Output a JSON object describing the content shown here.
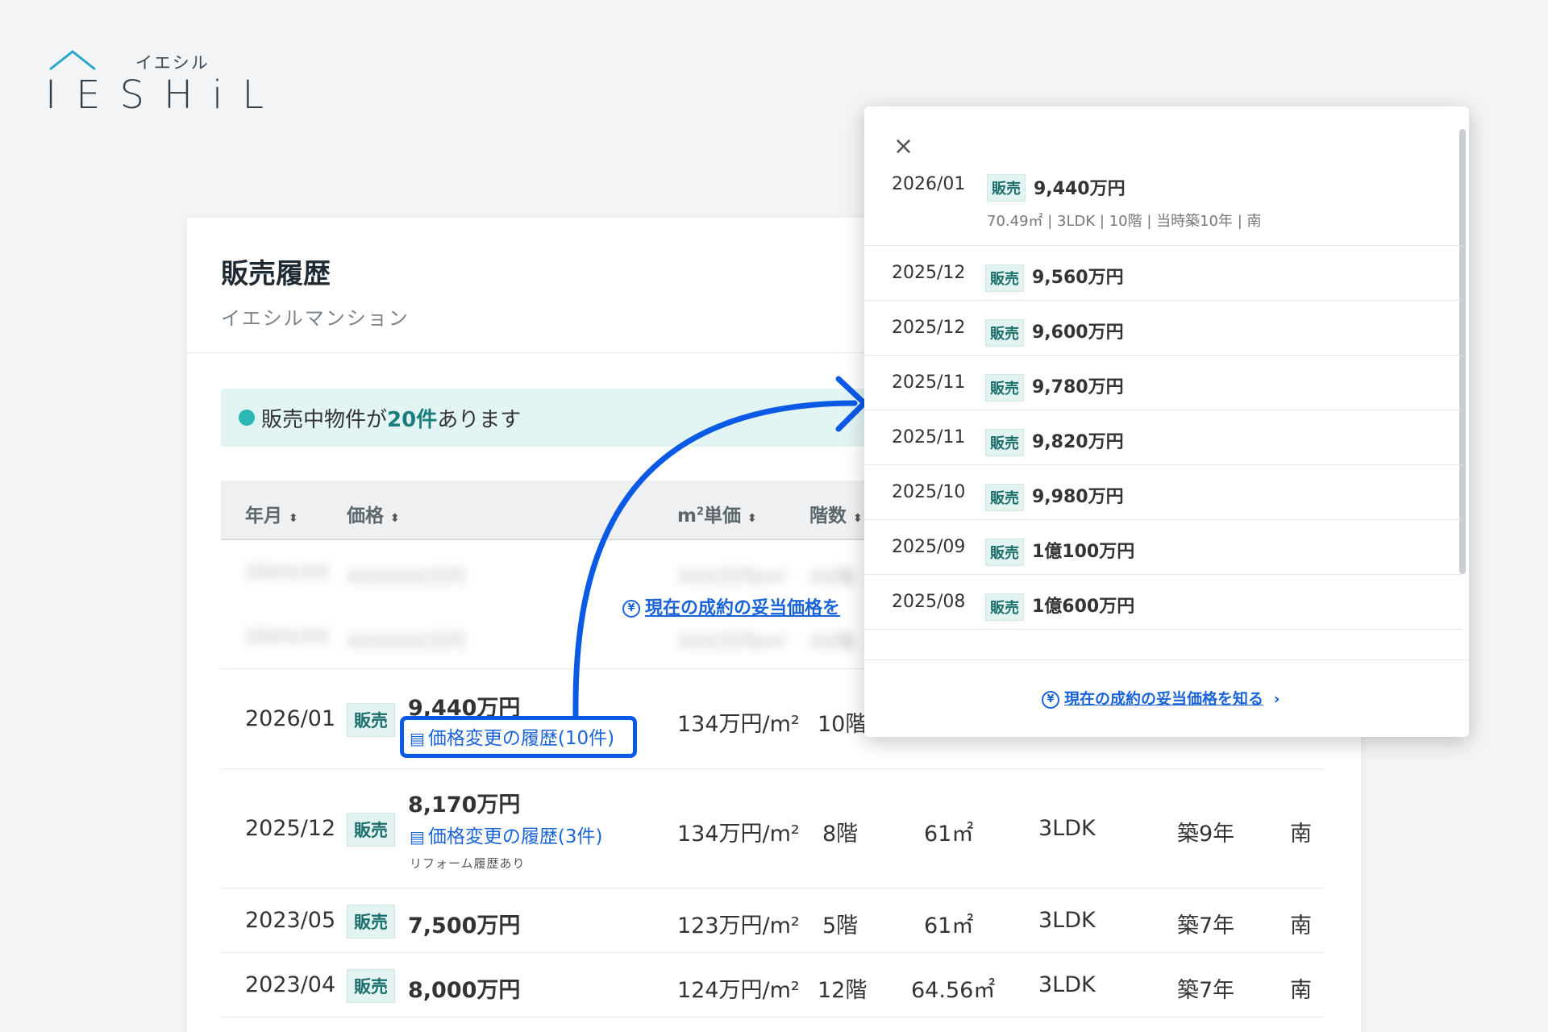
{
  "logo": {
    "kana": "イエシル",
    "word": "IESHiL"
  },
  "card": {
    "title": "販売履歴",
    "subtitle": "イエシルマンション"
  },
  "notice": {
    "prefix": "販売中物件が",
    "count": "20件",
    "suffix": "あります"
  },
  "table_headers": {
    "date": "年月",
    "price": "価格",
    "unit_price_prefix": "m",
    "unit_price_sup": "2",
    "unit_price_suffix": "単価",
    "floor": "階数",
    "sort_icon": "⬍"
  },
  "blurred_rows": [
    {
      "date": "20XX/XX",
      "price": "XXXXXX万円",
      "unit": "XXX万円/m²",
      "floor": "XX階"
    },
    {
      "date": "20XX/XX",
      "price": "XXXXXX万円",
      "unit": "XXX万円/m²",
      "floor": "XX階"
    }
  ],
  "appraisal_link_partial": "現在の成約の妥当価格を",
  "rows": [
    {
      "date": "2026/01",
      "badge": "販売",
      "price": "9,440万円",
      "history_link": "価格変更の履歴(10件)",
      "unit": "134万円/m²",
      "floor": "10階"
    },
    {
      "date": "2025/12",
      "badge": "販売",
      "price": "8,170万円",
      "history_link": "価格変更の履歴(3件)",
      "note": "リフォーム履歴あり",
      "unit": "134万円/m²",
      "floor": "8階",
      "area": "61㎡",
      "layout": "3LDK",
      "age": "築9年",
      "direction": "南"
    },
    {
      "date": "2023/05",
      "badge": "販売",
      "price": "7,500万円",
      "unit": "123万円/m²",
      "floor": "5階",
      "area": "61㎡",
      "layout": "3LDK",
      "age": "築7年",
      "direction": "南"
    },
    {
      "date": "2023/04",
      "badge": "販売",
      "price": "8,000万円",
      "unit": "124万円/m²",
      "floor": "12階",
      "area": "64.56㎡",
      "layout": "3LDK",
      "age": "築7年",
      "direction": "南"
    }
  ],
  "popup": {
    "close": "×",
    "first": {
      "date": "2026/01",
      "badge": "販売",
      "price": "9,440万円",
      "detail": "70.49㎡ | 3LDK | 10階 | 当時築10年 | 南"
    },
    "items": [
      {
        "date": "2025/12",
        "badge": "販売",
        "price": "9,560万円"
      },
      {
        "date": "2025/12",
        "badge": "販売",
        "price": "9,600万円"
      },
      {
        "date": "2025/11",
        "badge": "販売",
        "price": "9,780万円"
      },
      {
        "date": "2025/11",
        "badge": "販売",
        "price": "9,820万円"
      },
      {
        "date": "2025/10",
        "badge": "販売",
        "price": "9,980万円"
      },
      {
        "date": "2025/09",
        "badge": "販売",
        "price": "1億100万円"
      },
      {
        "date": "2025/08",
        "badge": "販売",
        "price": "1億600万円"
      }
    ],
    "footer_link": "現在の成約の妥当価格を知る",
    "footer_chevron": "›",
    "yen": "¥"
  },
  "colors": {
    "accent": "#1b64d8",
    "badge_bg": "#e2f3f1",
    "notice_bg": "#e3f4f4",
    "arrow": "#0b5ae6"
  }
}
